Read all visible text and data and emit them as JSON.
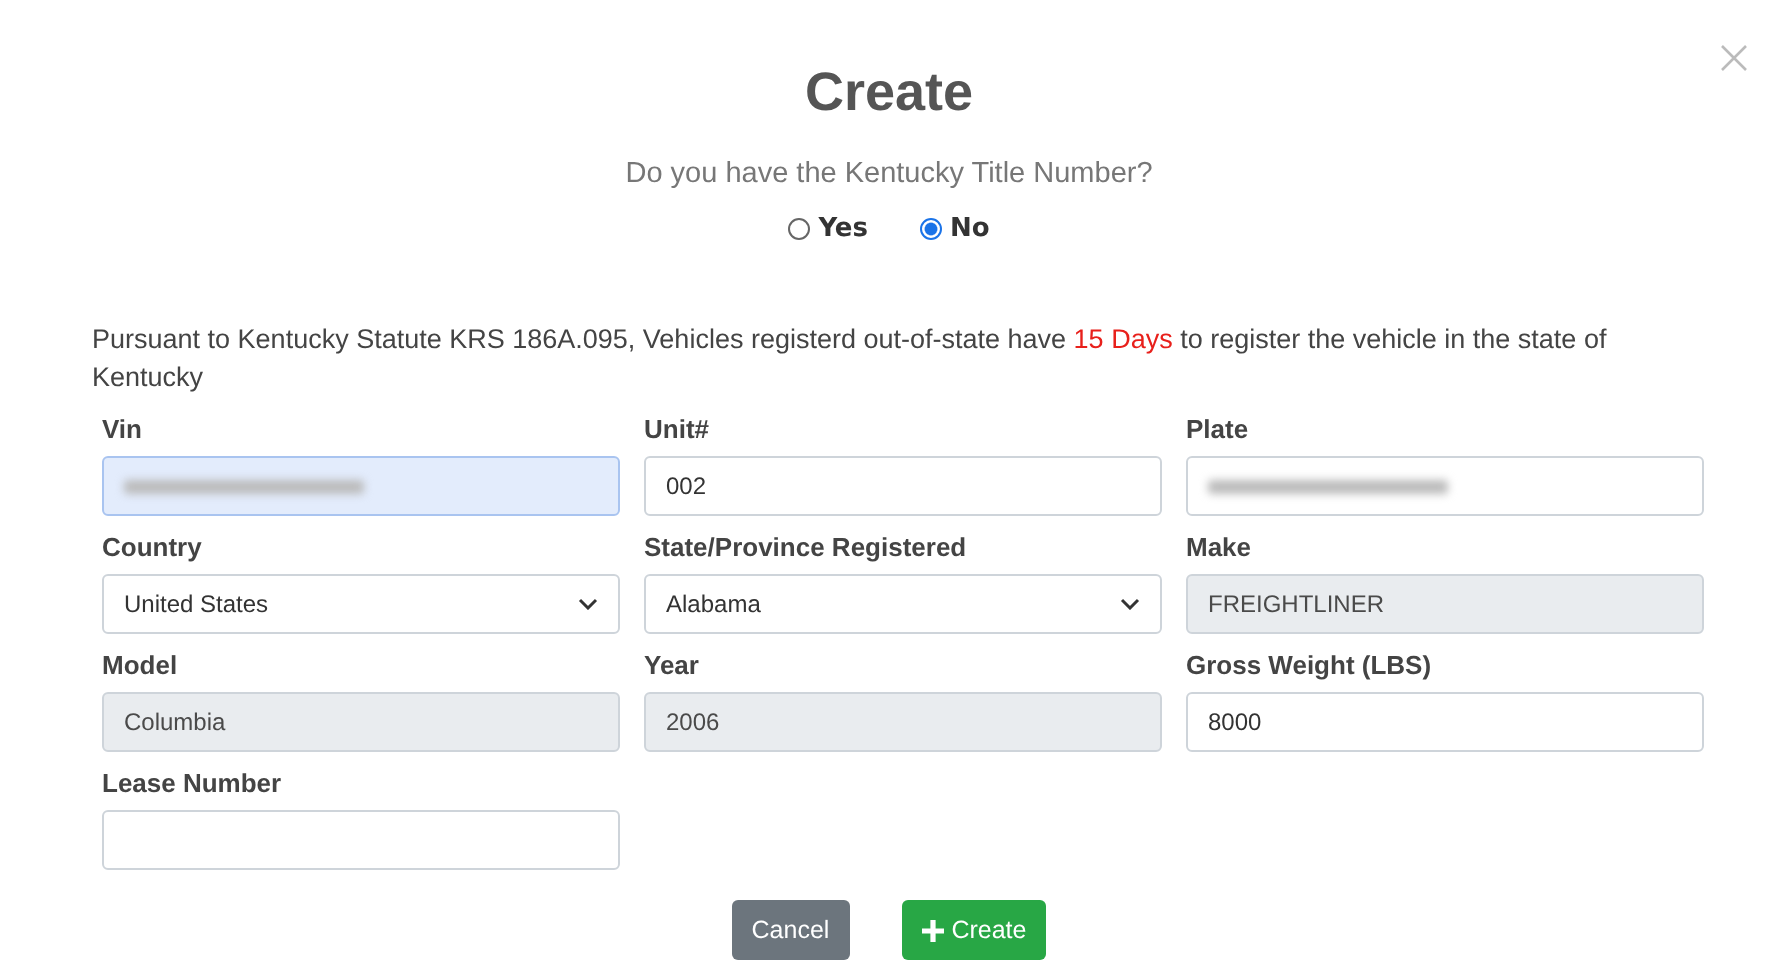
{
  "dialog": {
    "title": "Create",
    "question": "Do you have the Kentucky Title Number?",
    "options": [
      {
        "label": "Yes",
        "selected": false
      },
      {
        "label": "No",
        "selected": true
      }
    ],
    "notice": [
      {
        "kind": "plain",
        "text": "Pursuant to Kentucky Statute KRS 186A.095, Vehicles registerd out-of-state have "
      },
      {
        "kind": "highlight",
        "text": "15 Days"
      },
      {
        "kind": "plain",
        "text": " to register the vehicle in the state of Kentucky"
      }
    ],
    "fields": [
      {
        "label": "Vin",
        "kind": "text",
        "redacted": true,
        "focused": true,
        "readonly": false
      },
      {
        "label": "Unit#",
        "kind": "text",
        "value": "002",
        "focused": false,
        "readonly": false
      },
      {
        "label": "Plate",
        "kind": "text",
        "redacted": true,
        "focused": false,
        "readonly": false
      },
      {
        "label": "Country",
        "kind": "select",
        "value": "United States",
        "focused": false,
        "readonly": false
      },
      {
        "label": "State/Province Registered",
        "kind": "select",
        "value": "Alabama",
        "focused": false,
        "readonly": false
      },
      {
        "label": "Make",
        "kind": "text",
        "value": "FREIGHTLINER",
        "focused": false,
        "readonly": true
      },
      {
        "label": "Model",
        "kind": "text",
        "value": "Columbia",
        "focused": false,
        "readonly": true
      },
      {
        "label": "Year",
        "kind": "text",
        "value": "2006",
        "focused": false,
        "readonly": true
      },
      {
        "label": "Gross Weight (LBS)",
        "kind": "text",
        "value": "8000",
        "focused": false,
        "readonly": false
      },
      {
        "label": "Lease Number",
        "kind": "text",
        "focused": false,
        "readonly": false
      }
    ],
    "buttons": [
      {
        "kind": "secondary",
        "label": "Cancel"
      },
      {
        "kind": "primary",
        "label": "Create"
      }
    ]
  }
}
